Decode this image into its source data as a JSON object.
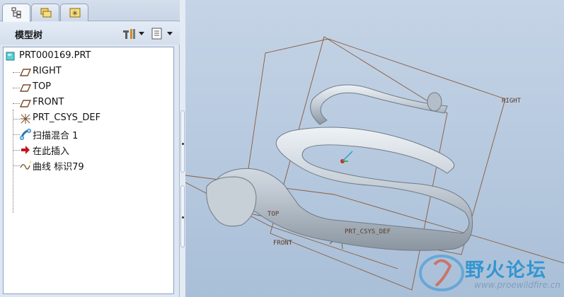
{
  "tabs": [
    {
      "name": "model-tree-tab",
      "icon": "model-tree-icon"
    },
    {
      "name": "folder-browser-tab",
      "icon": "folder-icon"
    },
    {
      "name": "favorites-tab",
      "icon": "favorites-icon"
    }
  ],
  "tree": {
    "title": "模型树",
    "settings_icon": "tree-settings-icon",
    "show_icon": "tree-columns-icon",
    "root": {
      "label": "PRT000169.PRT",
      "icon": "part-icon"
    },
    "items": [
      {
        "label": "RIGHT",
        "icon": "datum-plane-icon"
      },
      {
        "label": "TOP",
        "icon": "datum-plane-icon"
      },
      {
        "label": "FRONT",
        "icon": "datum-plane-icon"
      },
      {
        "label": "PRT_CSYS_DEF",
        "icon": "coordinate-system-icon"
      },
      {
        "label": "扫描混合 1",
        "icon": "swept-blend-icon"
      },
      {
        "label": "在此插入",
        "icon": "insert-here-arrow-icon"
      },
      {
        "label": "曲线 标识79",
        "icon": "curve-icon"
      }
    ]
  },
  "viewport": {
    "planes": {
      "right": "RIGHT",
      "top": "TOP",
      "front": "FRONT",
      "csys": "PRT_CSYS_DEF"
    },
    "colors": {
      "plane_line": "#8a5a3a",
      "spring_light": "#e4e9ee",
      "spring_mid": "#b8c2cc",
      "spring_dark": "#7f8a96"
    }
  },
  "watermark": {
    "title": "野火论坛",
    "url": "www.proewildfire.cn"
  }
}
